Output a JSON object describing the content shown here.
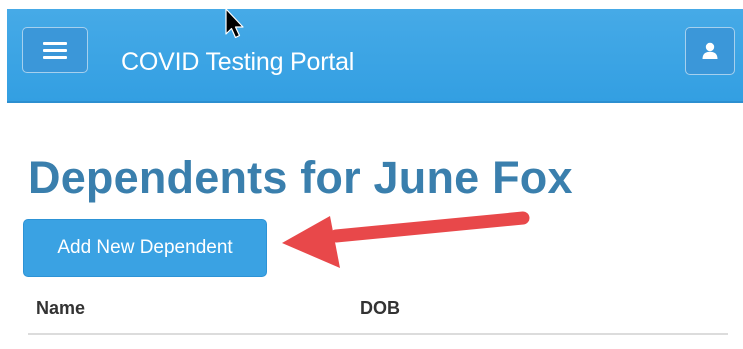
{
  "header": {
    "brand": "COVID Testing Portal",
    "menu_icon": "hamburger-menu-icon",
    "user_icon": "user-icon",
    "color": "#3aa2e3"
  },
  "main": {
    "title": "Dependents for June Fox",
    "title_color": "#3a7fad",
    "add_button_label": "Add New Dependent",
    "table": {
      "columns": [
        "Name",
        "DOB"
      ],
      "rows": []
    }
  },
  "annotations": {
    "arrow_color": "#e8484a",
    "cursor_icon": "mouse-pointer-icon"
  }
}
